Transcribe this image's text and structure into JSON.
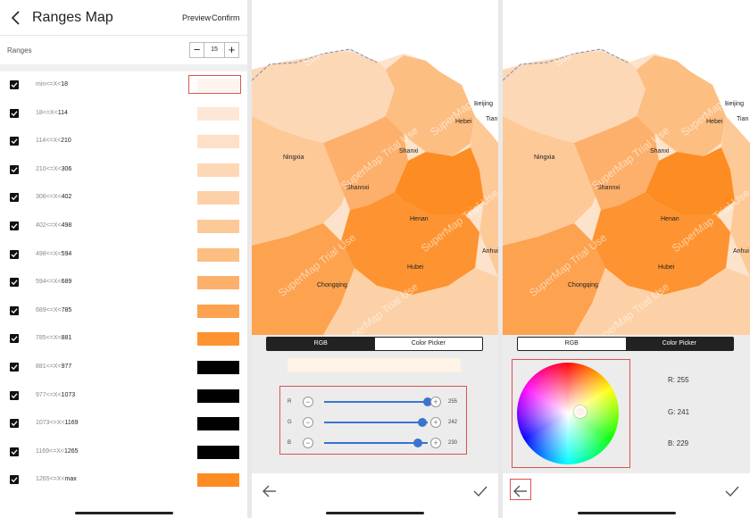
{
  "panel1": {
    "title": "Ranges Map",
    "preview": "Preview",
    "confirm": "Confirm",
    "ranges_label": "Ranges",
    "range_count": "15",
    "rows": [
      {
        "pre": "min<=X<",
        "num": "18",
        "color": "#fff5ee"
      },
      {
        "pre": "18<=X<",
        "num": "114",
        "color": "#fde7d6"
      },
      {
        "pre": "114<=X<",
        "num": "210",
        "color": "#fde0c7"
      },
      {
        "pre": "210<=X<",
        "num": "306",
        "color": "#fdd8b7"
      },
      {
        "pre": "306<=X<",
        "num": "402",
        "color": "#fdd1a7"
      },
      {
        "pre": "402<=X<",
        "num": "498",
        "color": "#fdc997"
      },
      {
        "pre": "498<=X<",
        "num": "594",
        "color": "#fdbe82"
      },
      {
        "pre": "594<=X<",
        "num": "689",
        "color": "#fdb06b"
      },
      {
        "pre": "689<=X<",
        "num": "785",
        "color": "#fda24f"
      },
      {
        "pre": "785<=X<",
        "num": "881",
        "color": "#fd9431"
      },
      {
        "pre": "881<=X<",
        "num": "977",
        "color": "#000000"
      },
      {
        "pre": "977<=X<",
        "num": "1073",
        "color": "#000000"
      },
      {
        "pre": "1073<=X<",
        "num": "1169",
        "color": "#000000"
      },
      {
        "pre": "1169<=X<",
        "num": "1265",
        "color": "#000000"
      },
      {
        "pre": "1265<=X<",
        "num": "max",
        "color": "#fd8c22"
      }
    ]
  },
  "map": {
    "watermark": "SuperMap Trial Use",
    "cities": [
      "Ningxia",
      "Shanxi",
      "Shannxi",
      "Henan",
      "Hubei",
      "Chongqing",
      "Beijing",
      "Hebei",
      "Tian",
      "Anhui"
    ]
  },
  "panel2": {
    "tab_rgb": "RGB",
    "tab_picker": "Color Picker",
    "preview_color": "#fff2e6",
    "sliders": [
      {
        "label": "R",
        "value": "255",
        "fraction": 1.0
      },
      {
        "label": "G",
        "value": "242",
        "fraction": 0.949
      },
      {
        "label": "B",
        "value": "230",
        "fraction": 0.902
      }
    ]
  },
  "panel3": {
    "tab_rgb": "RGB",
    "tab_picker": "Color Picker",
    "r_text": "R: 255",
    "g_text": "G: 241",
    "b_text": "B: 229"
  },
  "icons": {
    "back": "chevron-left-icon",
    "back_arrow": "arrow-left-icon",
    "confirm": "check-icon",
    "minus": "−",
    "plus": "+"
  }
}
